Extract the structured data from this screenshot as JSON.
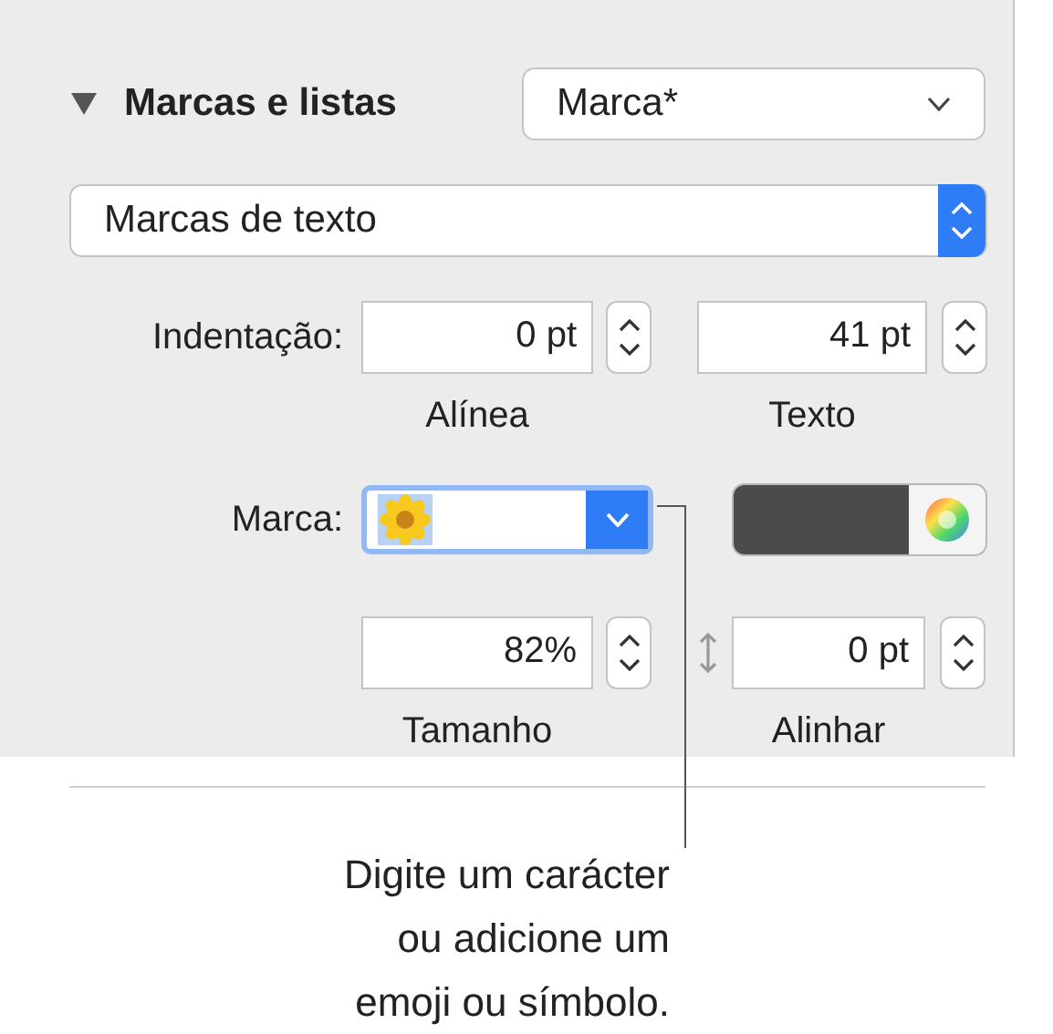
{
  "section": {
    "title": "Marcas e listas",
    "expanded": true,
    "style_menu": "Marca*"
  },
  "bullet_type": "Marcas de texto",
  "indent": {
    "label": "Indentação:",
    "fields": [
      {
        "value": "0 pt",
        "caption": "Alínea"
      },
      {
        "value": "41 pt",
        "caption": "Texto"
      }
    ]
  },
  "bullet": {
    "label": "Marca:"
  },
  "size": {
    "value": "82%",
    "caption": "Tamanho"
  },
  "align": {
    "value": "0 pt",
    "caption": "Alinhar"
  },
  "callout": [
    "Digite um carácter",
    "ou adicione um",
    "emoji ou símbolo."
  ]
}
